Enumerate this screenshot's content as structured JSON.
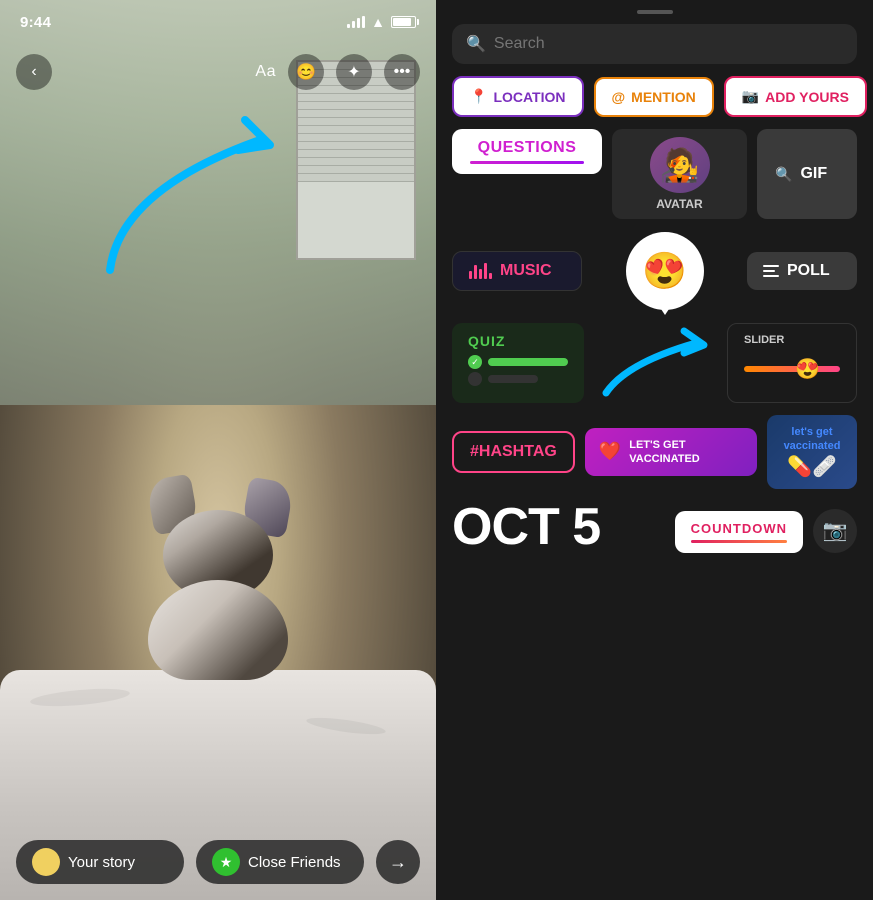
{
  "left": {
    "status": {
      "time": "9:44"
    },
    "toolbar": {
      "back_label": "‹",
      "text_label": "Aa",
      "sticker_icon": "😊",
      "sparkle_label": "✦",
      "more_label": "•••"
    },
    "story_options": {
      "your_story": "Your story",
      "close_friends": "Close Friends",
      "send_arrow": "→"
    }
  },
  "right": {
    "search": {
      "placeholder": "Search"
    },
    "stickers": {
      "location": "LOCATION",
      "mention": "@MENTION",
      "add_yours": "ADD YOURS",
      "questions": "QUESTIONS",
      "avatar": "AVATAR",
      "gif": "GIF",
      "music": "MUSIC",
      "poll": "POLL",
      "quiz": "QUIZ",
      "hashtag": "#HASHTAG",
      "lets_get_vaccinated": "LET'S GET\nVACCINATED",
      "countdown": "COUNTDOWN",
      "oct": "OCT 5"
    }
  }
}
